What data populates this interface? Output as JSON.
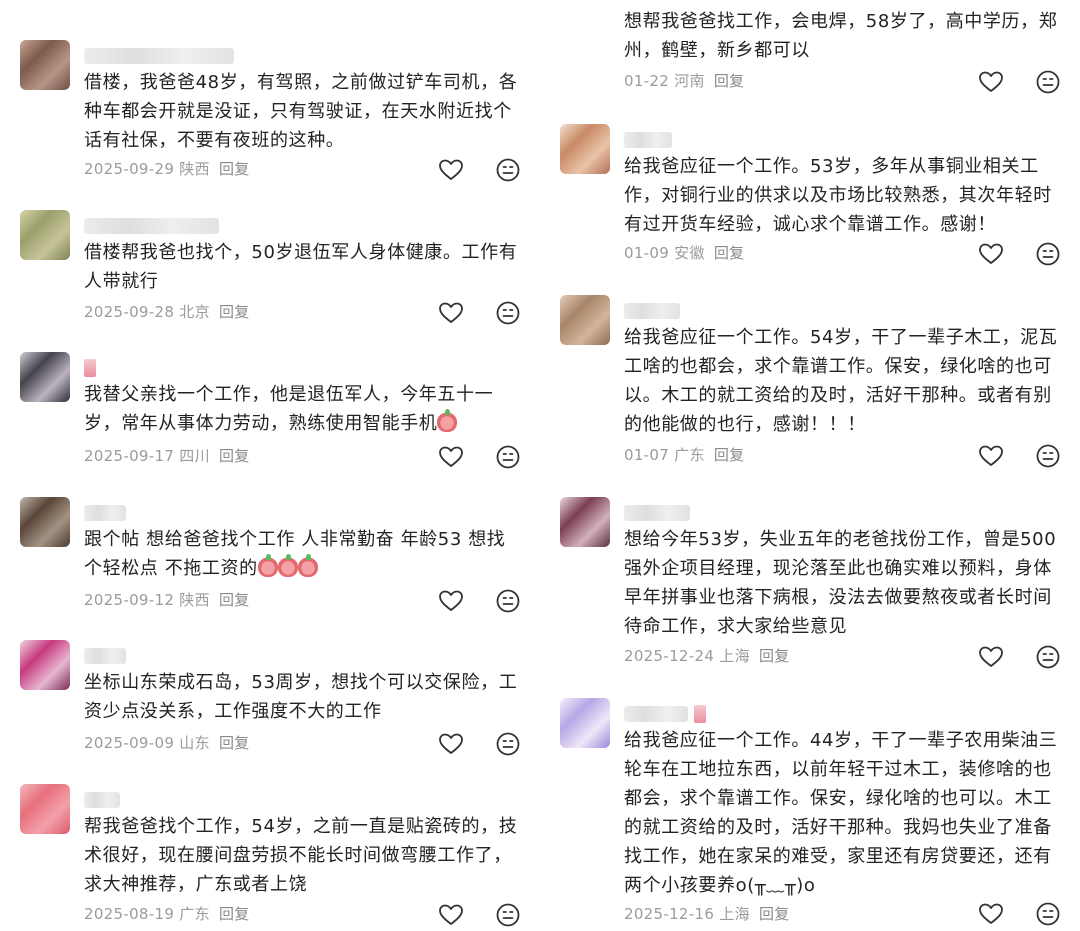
{
  "left": [
    {
      "text": "借楼，我爸爸48岁，有驾照，之前做过铲车司机，各种车都会开就是没证，只有驾驶证，在天水附近找个话有社保，不要有夜班的这种。",
      "date": "2025-09-29",
      "region": "陕西",
      "reply": "回复"
    },
    {
      "text": "借楼帮我爸也找个，50岁退伍军人身体健康。工作有人带就行",
      "date": "2025-09-28",
      "region": "北京",
      "reply": "回复"
    },
    {
      "text": "我替父亲找一个工作，他是退伍军人，今年五十一岁，常年从事体力劳动，熟练使用智能手机",
      "date": "2025-09-17",
      "region": "四川",
      "reply": "回复"
    },
    {
      "text": "跟个帖 想给爸爸找个工作 人非常勤奋 年龄53 想找个轻松点 不拖工资的",
      "date": "2025-09-12",
      "region": "陕西",
      "reply": "回复"
    },
    {
      "text": "坐标山东荣成石岛，53周岁，想找个可以交保险，工资少点没关系，工作强度不大的工作",
      "date": "2025-09-09",
      "region": "山东",
      "reply": "回复"
    },
    {
      "text": "帮我爸爸找个工作，54岁，之前一直是贴瓷砖的，技术很好，现在腰间盘劳损不能长时间做弯腰工作了，求大神推荐，广东或者上饶",
      "date": "2025-08-19",
      "region": "广东",
      "reply": "回复"
    }
  ],
  "right": [
    {
      "text": "想帮我爸爸找工作，会电焊，58岁了，高中学历，郑州，鹤壁，新乡都可以",
      "date": "01-22",
      "region": "河南",
      "reply": "回复"
    },
    {
      "text": "给我爸应征一个工作。53岁，多年从事铜业相关工作，对铜行业的供求以及市场比较熟悉，其次年轻时有过开货车经验，诚心求个靠谱工作。感谢！",
      "date": "01-09",
      "region": "安徽",
      "reply": "回复"
    },
    {
      "text": "给我爸应征一个工作。54岁，干了一辈子木工，泥瓦工啥的也都会，求个靠谱工作。保安，绿化啥的也可以。木工的就工资给的及时，活好干那种。或者有别的他能做的也行，感谢！！！",
      "date": "01-07",
      "region": "广东",
      "reply": "回复"
    },
    {
      "text": "想给今年53岁，失业五年的老爸找份工作，曾是500强外企项目经理，现沦落至此也确实难以预料，身体早年拼事业也落下病根，没法去做要熬夜或者长时间待命工作，求大家给些意见",
      "date": "2025-12-24",
      "region": "上海",
      "reply": "回复"
    },
    {
      "text": "给我爸应征一个工作。44岁，干了一辈子农用柴油三轮车在工地拉东西，以前年轻干过木工，装修啥的也都会，求个靠谱工作。保安，绿化啥的也可以。木工的就工资给的及时，活好干那种。我妈也失业了准备找工作，她在家呆的难受，家里还有房贷要还，还有两个小孩要养o(╥﹏╥)o",
      "date": "2025-12-16",
      "region": "上海",
      "reply": "回复"
    }
  ],
  "icons": {
    "like": "heart-outline-icon",
    "dislike": "neutral-face-icon",
    "emoji": "peach-emoji-icon"
  },
  "colors": {
    "text": "#232323",
    "meta": "#9b9b9b",
    "icon": "#333333"
  }
}
